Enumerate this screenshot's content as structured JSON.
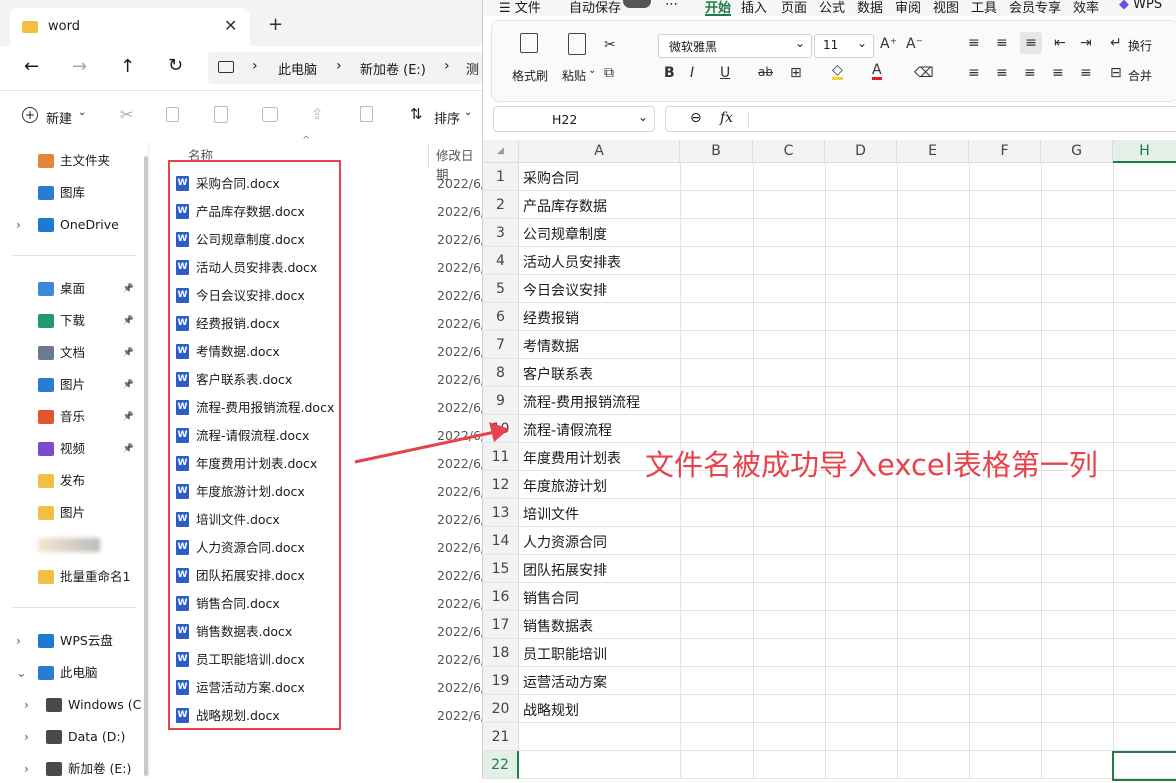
{
  "explorer": {
    "tab_title": "word",
    "breadcrumb": [
      "此电脑",
      "新加卷 (E:)",
      "测"
    ],
    "toolbar": {
      "new_label": "新建",
      "sort_label": "排序"
    },
    "column_name": "名称",
    "column_date": "修改日期",
    "nav": [
      {
        "label": "主文件夹",
        "icon": "home-icon",
        "color": "#e0883a"
      },
      {
        "label": "图库",
        "icon": "gallery-icon",
        "color": "#2b7bd1"
      },
      {
        "label": "OneDrive",
        "icon": "cloud-icon",
        "color": "#1f78d1"
      },
      {
        "label": "桌面",
        "icon": "desktop-icon",
        "color": "#3a8ad6"
      },
      {
        "label": "下载",
        "icon": "download-icon",
        "color": "#1e9d6a"
      },
      {
        "label": "文档",
        "icon": "document-icon",
        "color": "#6b7a90"
      },
      {
        "label": "图片",
        "icon": "pictures-icon",
        "color": "#2b7bd1"
      },
      {
        "label": "音乐",
        "icon": "music-icon",
        "color": "#e2552f"
      },
      {
        "label": "视频",
        "icon": "video-icon",
        "color": "#7a4bd1"
      },
      {
        "label": "发布",
        "icon": "folder-icon",
        "color": "#f2c041"
      },
      {
        "label": "图片",
        "icon": "folder-icon",
        "color": "#f2c041"
      },
      {
        "label": "",
        "icon": "blurred-icon",
        "color": "#d9d2c4"
      },
      {
        "label": "批量重命名1",
        "icon": "folder-icon",
        "color": "#f2c041"
      },
      {
        "label": "WPS云盘",
        "icon": "cloud-icon",
        "color": "#1f78d1"
      },
      {
        "label": "此电脑",
        "icon": "pc-icon",
        "color": "#2b7bd1"
      },
      {
        "label": "Windows (C",
        "icon": "drive-icon",
        "color": "#4a4a4a"
      },
      {
        "label": "Data (D:)",
        "icon": "drive-icon",
        "color": "#4a4a4a"
      },
      {
        "label": "新加卷 (E:)",
        "icon": "drive-icon",
        "color": "#4a4a4a"
      }
    ],
    "files": [
      {
        "name": "采购合同.docx",
        "date": "2022/6/"
      },
      {
        "name": "产品库存数据.docx",
        "date": "2022/6/"
      },
      {
        "name": "公司规章制度.docx",
        "date": "2022/6/"
      },
      {
        "name": "活动人员安排表.docx",
        "date": "2022/6/"
      },
      {
        "name": "今日会议安排.docx",
        "date": "2022/6/"
      },
      {
        "name": "经费报销.docx",
        "date": "2022/6/"
      },
      {
        "name": "考情数据.docx",
        "date": "2022/6/"
      },
      {
        "name": "客户联系表.docx",
        "date": "2022/6/"
      },
      {
        "name": "流程-费用报销流程.docx",
        "date": "2022/6/"
      },
      {
        "name": "流程-请假流程.docx",
        "date": "2022/6/"
      },
      {
        "name": "年度费用计划表.docx",
        "date": "2022/6/"
      },
      {
        "name": "年度旅游计划.docx",
        "date": "2022/6/"
      },
      {
        "name": "培训文件.docx",
        "date": "2022/6/"
      },
      {
        "name": "人力资源合同.docx",
        "date": "2022/6/"
      },
      {
        "name": "团队拓展安排.docx",
        "date": "2022/6/"
      },
      {
        "name": "销售合同.docx",
        "date": "2022/6/"
      },
      {
        "name": "销售数据表.docx",
        "date": "2022/6/"
      },
      {
        "name": "员工职能培训.docx",
        "date": "2022/6/"
      },
      {
        "name": "运营活动方案.docx",
        "date": "2022/6/"
      },
      {
        "name": "战略规划.docx",
        "date": "2022/6/"
      }
    ]
  },
  "wps": {
    "menu": [
      "文件",
      "自动保存",
      "开始",
      "插入",
      "页面",
      "公式",
      "数据",
      "审阅",
      "视图",
      "工具",
      "会员专享",
      "效率",
      "WPS"
    ],
    "ribbon": {
      "format_painter": "格式刷",
      "paste": "粘贴",
      "font_name": "微软雅黑",
      "font_size": "11",
      "wrap": "换行",
      "merge": "合并"
    },
    "name_box": "H22",
    "fx_label": "fx",
    "columns": [
      "A",
      "B",
      "C",
      "D",
      "E",
      "F",
      "G",
      "H"
    ],
    "rows": [
      {
        "n": "1",
        "a": "采购合同"
      },
      {
        "n": "2",
        "a": "产品库存数据"
      },
      {
        "n": "3",
        "a": "公司规章制度"
      },
      {
        "n": "4",
        "a": "活动人员安排表"
      },
      {
        "n": "5",
        "a": "今日会议安排"
      },
      {
        "n": "6",
        "a": "经费报销"
      },
      {
        "n": "7",
        "a": "考情数据"
      },
      {
        "n": "8",
        "a": "客户联系表"
      },
      {
        "n": "9",
        "a": "流程-费用报销流程"
      },
      {
        "n": "10",
        "a": "流程-请假流程"
      },
      {
        "n": "11",
        "a": "年度费用计划表"
      },
      {
        "n": "12",
        "a": "年度旅游计划"
      },
      {
        "n": "13",
        "a": "培训文件"
      },
      {
        "n": "14",
        "a": "人力资源合同"
      },
      {
        "n": "15",
        "a": "团队拓展安排"
      },
      {
        "n": "16",
        "a": "销售合同"
      },
      {
        "n": "17",
        "a": "销售数据表"
      },
      {
        "n": "18",
        "a": "员工职能培训"
      },
      {
        "n": "19",
        "a": "运营活动方案"
      },
      {
        "n": "20",
        "a": "战略规划"
      },
      {
        "n": "21",
        "a": ""
      },
      {
        "n": "22",
        "a": ""
      }
    ],
    "accent": "#1e7c45"
  },
  "annotation": "文件名被成功导入excel表格第一列",
  "annotation_color": "#e8424a"
}
